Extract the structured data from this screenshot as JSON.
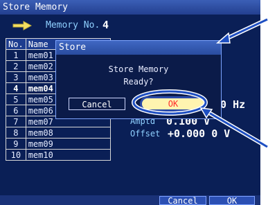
{
  "title_bar": {
    "text": "Store Memory"
  },
  "memory_number": {
    "label": "Memory No.",
    "value": "4"
  },
  "table": {
    "headers": [
      "No.",
      "Name"
    ],
    "rows": [
      {
        "no": "1",
        "name": "mem01"
      },
      {
        "no": "2",
        "name": "mem02"
      },
      {
        "no": "3",
        "name": "mem03"
      },
      {
        "no": "4",
        "name": "mem04"
      },
      {
        "no": "5",
        "name": "mem05"
      },
      {
        "no": "6",
        "name": "mem06"
      },
      {
        "no": "7",
        "name": "mem07"
      },
      {
        "no": "8",
        "name": "mem08"
      },
      {
        "no": "9",
        "name": "mem09"
      },
      {
        "no": "10",
        "name": "mem10"
      }
    ],
    "selected_index": 3
  },
  "right_panel": {
    "frequency_value": "000 Hz",
    "amplitude_label": "Amptd",
    "amplitude_value": "0.100 V",
    "offset_label": "Offset",
    "offset_value": "+0.000 0 V"
  },
  "dialog": {
    "title": "Store",
    "message_line1": "Store Memory",
    "message_line2": "Ready?",
    "cancel_label": "Cancel",
    "ok_label": "OK"
  },
  "softkeys": {
    "cancel_label": "Cancel",
    "ok_label": "OK"
  },
  "colors": {
    "screen_bg": "#0a1f56",
    "title_bar": "#2f4fa3",
    "annotation": "#1e4fc2",
    "ok_highlight": "#fff4b0",
    "ok_text": "#ff2a2a"
  },
  "icons": {
    "arrow": "arrow-right-icon"
  }
}
